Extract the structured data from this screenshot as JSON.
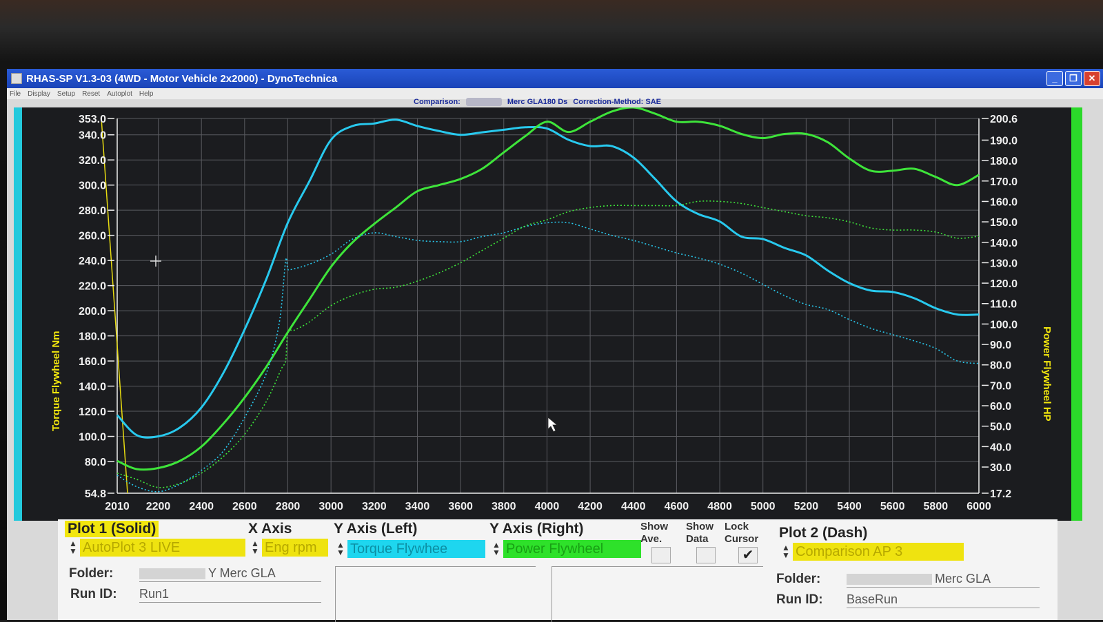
{
  "window": {
    "title": "RHAS-SP V1.3-03  (4WD - Motor Vehicle 2x2000) - DynoTechnica",
    "minimize_icon": "minimize-icon",
    "restore_icon": "restore-icon",
    "close_icon": "close-icon"
  },
  "menu": [
    "File",
    "Display",
    "Setup",
    "Reset",
    "Autoplot",
    "Help"
  ],
  "comparison": {
    "label": "Comparison:",
    "vehicle": "Merc GLA180 Ds",
    "correction": "Correction-Method: SAE"
  },
  "colors": {
    "torque": "#28c9ee",
    "power": "#3ee43a",
    "axis_left": "#2fd6e6",
    "axis_right": "#2fe02a",
    "yellow": "#f2e60e"
  },
  "chart_data": {
    "type": "line",
    "xlabel": "",
    "ylabel_left": "Torque Flywheel Nm",
    "ylabel_right": "Power Flywheel HP",
    "xlim": [
      2010,
      6000
    ],
    "ylim_left": [
      54.8,
      353.0
    ],
    "ylim_right": [
      17.2,
      200.6
    ],
    "grid": true,
    "x_ticks": [
      "2010",
      "2200",
      "2400",
      "2600",
      "2800",
      "3000",
      "3200",
      "3400",
      "3600",
      "3800",
      "4000",
      "4200",
      "4400",
      "4600",
      "4800",
      "5000",
      "5200",
      "5400",
      "5600",
      "5800",
      "6000"
    ],
    "y_left_ticks": [
      "54.8",
      "80.0",
      "100.0",
      "120.0",
      "140.0",
      "160.0",
      "180.0",
      "200.0",
      "220.0",
      "240.0",
      "260.0",
      "280.0",
      "300.0",
      "320.0",
      "340.0",
      "353.0"
    ],
    "y_right_ticks": [
      "17.2",
      "30.0",
      "40.0",
      "50.0",
      "60.0",
      "70.0",
      "80.0",
      "90.0",
      "100.0",
      "110.0",
      "120.0",
      "130.0",
      "140.0",
      "150.0",
      "160.0",
      "170.0",
      "180.0",
      "190.0",
      "200.6"
    ],
    "series": [
      {
        "name": "Torque Flywheel",
        "axis": "left",
        "style": "solid",
        "color": "#28c9ee",
        "x": [
          2010,
          2100,
          2200,
          2300,
          2400,
          2500,
          2600,
          2700,
          2800,
          2900,
          3000,
          3100,
          3200,
          3300,
          3400,
          3500,
          3600,
          3700,
          3800,
          3900,
          4000,
          4100,
          4200,
          4300,
          4400,
          4500,
          4600,
          4700,
          4800,
          4900,
          5000,
          5100,
          5200,
          5300,
          5400,
          5500,
          5600,
          5700,
          5800,
          5900,
          6000
        ],
        "y": [
          117,
          101,
          100,
          107,
          123,
          150,
          185,
          225,
          270,
          303,
          336,
          347,
          349,
          352,
          347,
          343,
          340,
          342,
          344,
          346,
          345,
          336,
          331,
          331,
          322,
          305,
          287,
          277,
          271,
          259,
          257,
          250,
          244,
          232,
          222,
          216,
          215,
          210,
          202,
          197,
          197
        ]
      },
      {
        "name": "Power Flywheel",
        "axis": "right",
        "style": "solid",
        "color": "#3ee43a",
        "x": [
          2010,
          2100,
          2200,
          2300,
          2400,
          2500,
          2600,
          2700,
          2800,
          2900,
          3000,
          3100,
          3200,
          3300,
          3400,
          3500,
          3600,
          3700,
          3800,
          3900,
          4000,
          4100,
          4200,
          4300,
          4400,
          4500,
          4600,
          4700,
          4800,
          4900,
          5000,
          5100,
          5200,
          5300,
          5400,
          5500,
          5600,
          5700,
          5800,
          5900,
          6000
        ],
        "y": [
          33,
          29,
          29.5,
          33,
          40,
          51,
          64,
          79,
          96,
          112,
          128,
          140,
          149,
          157,
          165,
          168,
          171,
          176,
          184,
          192,
          199,
          194,
          199,
          204,
          206,
          203,
          199,
          199,
          197,
          193,
          191,
          193,
          193,
          189,
          181,
          175,
          175,
          176,
          172,
          168,
          173
        ]
      },
      {
        "name": "Comparison AP 3 Torque",
        "axis": "left",
        "style": "dash",
        "color": "#28c9ee",
        "x": [
          2010,
          2100,
          2200,
          2300,
          2400,
          2500,
          2600,
          2700,
          2760,
          2790,
          2800,
          2820,
          2900,
          3000,
          3100,
          3200,
          3300,
          3400,
          3500,
          3600,
          3700,
          3800,
          3900,
          4000,
          4100,
          4200,
          4300,
          4400,
          4500,
          4600,
          4700,
          4800,
          4900,
          5000,
          5100,
          5200,
          5300,
          5400,
          5500,
          5600,
          5700,
          5800,
          5900,
          6000
        ],
        "y": [
          69,
          60,
          56,
          62,
          73,
          88,
          115,
          150,
          190,
          240,
          233,
          233,
          237,
          245,
          257,
          262,
          259,
          256,
          255,
          255,
          259,
          262,
          267,
          270,
          270,
          265,
          260,
          256,
          251,
          246,
          242,
          237,
          230,
          221,
          212,
          205,
          201,
          193,
          186,
          181,
          176,
          170,
          160,
          158
        ]
      },
      {
        "name": "Comparison AP 3 Power",
        "axis": "right",
        "style": "dash",
        "color": "#3ee43a",
        "x": [
          2010,
          2100,
          2200,
          2300,
          2400,
          2500,
          2600,
          2700,
          2770,
          2790,
          2800,
          2830,
          2900,
          3000,
          3100,
          3200,
          3300,
          3400,
          3500,
          3600,
          3700,
          3800,
          3900,
          4000,
          4100,
          4200,
          4300,
          4400,
          4500,
          4600,
          4700,
          4800,
          4900,
          5000,
          5100,
          5200,
          5300,
          5400,
          5500,
          5600,
          5700,
          5800,
          5900,
          6000
        ],
        "y": [
          27,
          24,
          20,
          22,
          27,
          35,
          46,
          62,
          78,
          82,
          96,
          97,
          101,
          109,
          114,
          117,
          118,
          121,
          125,
          130,
          136,
          142,
          148,
          151,
          155,
          157,
          158,
          158,
          158,
          158,
          160,
          160,
          159,
          157,
          155,
          153,
          152,
          150,
          147,
          146,
          146,
          145,
          142,
          143
        ]
      }
    ]
  },
  "controls": {
    "plot1_label": "Plot 1 (Solid)",
    "x_axis_label": "X Axis",
    "y_left_label": "Y Axis (Left)",
    "y_right_label": "Y Axis (Right)",
    "show_ave_label": "Show Ave.",
    "show_data_label": "Show Data",
    "lock_cursor_label": "Lock Cursor",
    "plot2_label": "Plot 2 (Dash)",
    "plot1_value": "AutoPlot 3 LIVE",
    "x_axis_value": "Eng rpm",
    "y_left_value": "Torque Flywhee",
    "y_right_value": "Power Flywheel",
    "plot2_value": "Comparison AP 3",
    "folder_label": "Folder:",
    "runid_label": "Run ID:",
    "folder1_value": "Y Merc GLA",
    "runid1_value": "Run1",
    "folder2_value": "Merc GLA",
    "runid2_value": "BaseRun",
    "show_ave_checked": false,
    "show_data_checked": false,
    "lock_cursor_checked": true
  }
}
